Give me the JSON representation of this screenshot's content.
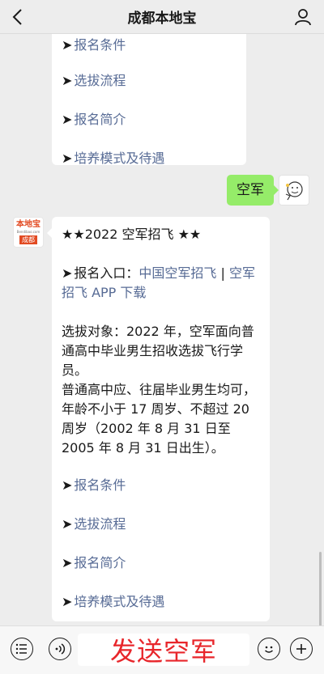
{
  "header": {
    "title": "成都本地宝"
  },
  "chat": {
    "prev_bubble": {
      "items": [
        {
          "arrow": "➤",
          "text": "报名条件"
        },
        {
          "arrow": "➤",
          "text": "选拔流程"
        },
        {
          "arrow": "➤",
          "text": "报名简介"
        },
        {
          "arrow": "➤",
          "text": "培养模式及待遇"
        }
      ]
    },
    "user_message": "空军",
    "bot_avatar": {
      "line1": "本地宝",
      "line2": "Bendibao.com",
      "line3": "成都"
    },
    "bot_message": {
      "title": "★★2022 空军招飞 ★★",
      "entry_arrow": "➤",
      "entry_label": "报名入口：",
      "entry_link1": "中国空军招飞",
      "entry_sep": " | ",
      "entry_link2": "空军",
      "entry_link2b": "招飞 APP 下载",
      "para1": "选拔对象：2022 年，空军面向普通高中毕业男生招收选拔飞行学员。",
      "para2": "普通高中应、往届毕业男生均可，年龄不小于 17 周岁、不超过 20 周岁（2002 年 8 月 31 日至 2005 年 8 月 31 日出生）。",
      "items": [
        {
          "arrow": "➤",
          "text": "报名条件"
        },
        {
          "arrow": "➤",
          "text": "选拔流程"
        },
        {
          "arrow": "➤",
          "text": "报名简介"
        },
        {
          "arrow": "➤",
          "text": "培养模式及待遇"
        }
      ]
    }
  },
  "input": {
    "value": "发送空军"
  },
  "colors": {
    "link": "#576b95",
    "user_bubble": "#95ec69",
    "input_text": "#e8262b"
  },
  "icons": [
    "back-arrow-icon",
    "user-icon",
    "menu-icon",
    "voice-icon",
    "emoji-icon",
    "plus-icon"
  ]
}
